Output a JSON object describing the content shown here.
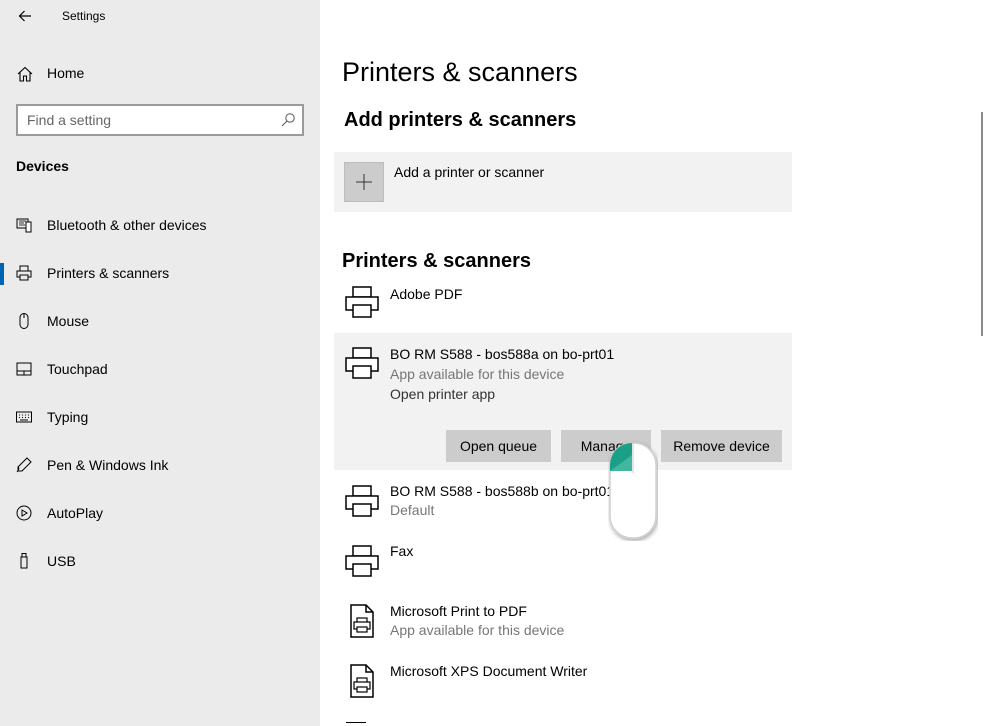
{
  "window": {
    "app_title": "Settings",
    "minimize_icon": "minimize-icon",
    "maximize_icon": "maximize-icon",
    "close_icon": "close-icon"
  },
  "sidebar": {
    "home_label": "Home",
    "search_placeholder": "Find a setting",
    "section_label": "Devices",
    "items": [
      {
        "label": "Bluetooth & other devices",
        "icon": "bluetooth-devices-icon"
      },
      {
        "label": "Printers & scanners",
        "icon": "printer-icon",
        "selected": true
      },
      {
        "label": "Mouse",
        "icon": "mouse-icon"
      },
      {
        "label": "Touchpad",
        "icon": "touchpad-icon"
      },
      {
        "label": "Typing",
        "icon": "keyboard-icon"
      },
      {
        "label": "Pen & Windows Ink",
        "icon": "pen-icon"
      },
      {
        "label": "AutoPlay",
        "icon": "autoplay-icon"
      },
      {
        "label": "USB",
        "icon": "usb-icon"
      }
    ]
  },
  "main": {
    "page_title": "Printers & scanners",
    "add_section_title": "Add printers & scanners",
    "add_label": "Add a printer or scanner",
    "list_title": "Printers & scanners",
    "printers": [
      {
        "name": "Adobe PDF"
      },
      {
        "name": "BO RM S588 - bos588a on bo-prt01",
        "sub": "App available for this device",
        "link": "Open printer app"
      },
      {
        "name": "BO RM S588 - bos588b on bo-prt01",
        "sub": "Default"
      },
      {
        "name": "Fax"
      },
      {
        "name": "Microsoft Print to PDF",
        "sub": "App available for this device"
      },
      {
        "name": "Microsoft XPS Document Writer"
      }
    ],
    "buttons": {
      "open_queue": "Open queue",
      "manage": "Manage",
      "remove_device": "Remove device"
    }
  },
  "colors": {
    "sidebar_bg": "#ebebeb",
    "accent": "#0063b1",
    "button_bg": "#cccccc",
    "card_bg": "#f2f2f2"
  }
}
